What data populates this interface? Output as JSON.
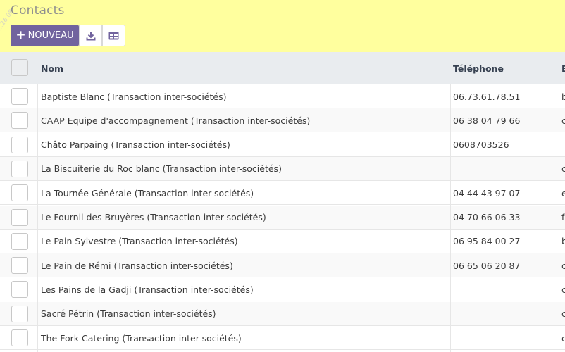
{
  "header": {
    "title": "Contacts",
    "new_button_label": "NOUVEAU",
    "watermark": "...26 08"
  },
  "table": {
    "columns": [
      "Nom",
      "Téléphone",
      "E"
    ],
    "rows": [
      {
        "name": "Baptiste Blanc (Transaction inter-sociétés)",
        "phone": "06.73.61.78.51",
        "email": "b"
      },
      {
        "name": "CAAP Equipe d'accompagnement (Transaction inter-sociétés)",
        "phone": "06 38 04 79 66",
        "email": "c"
      },
      {
        "name": "Châto Parpaing (Transaction inter-sociétés)",
        "phone": "0608703526",
        "email": ""
      },
      {
        "name": "La Biscuiterie du Roc blanc (Transaction inter-sociétés)",
        "phone": "",
        "email": "c"
      },
      {
        "name": "La Tournée Générale (Transaction inter-sociétés)",
        "phone": "04 44 43 97 07",
        "email": "e"
      },
      {
        "name": "Le Fournil des Bruyères (Transaction inter-sociétés)",
        "phone": "04 70 66 06 33",
        "email": "f"
      },
      {
        "name": "Le Pain Sylvestre (Transaction inter-sociétés)",
        "phone": "06 95 84 00 27",
        "email": "b"
      },
      {
        "name": "Le Pain de Rémi (Transaction inter-sociétés)",
        "phone": "06 65 06 20 87",
        "email": "c"
      },
      {
        "name": "Les Pains de la Gadji (Transaction inter-sociétés)",
        "phone": "",
        "email": "c"
      },
      {
        "name": "Sacré Pétrin (Transaction inter-sociétés)",
        "phone": "",
        "email": "c"
      },
      {
        "name": "The Fork Catering (Transaction inter-sociétés)",
        "phone": "",
        "email": "c"
      }
    ]
  },
  "colors": {
    "header_bg": "#ffff9e",
    "primary": "#71639e",
    "table_header_bg": "#e9ecef"
  }
}
